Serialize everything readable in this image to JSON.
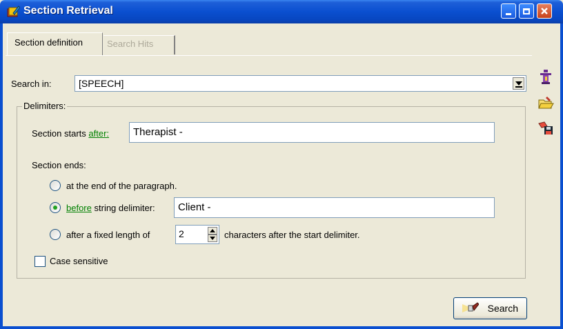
{
  "window": {
    "title": "Section Retrieval",
    "icon": "book-pencil-icon",
    "controls": [
      "minimize",
      "maximize",
      "close"
    ],
    "accent": "#0a4fd0"
  },
  "tabs": [
    {
      "label": "Section definition",
      "active": true
    },
    {
      "label": "Search Hits",
      "active": false
    }
  ],
  "search_in": {
    "label": "Search in:",
    "value": "[SPEECH]"
  },
  "delimiters": {
    "group_label": "Delimiters:",
    "starts_prefix": "Section starts",
    "starts_link": "after:",
    "starts_value": "Therapist -",
    "ends_label": "Section ends:",
    "option_paragraph": "at the end of the paragraph.",
    "option_before_link": "before",
    "option_before_text": "string delimiter:",
    "option_before_value": "Client -",
    "option_fixed_prefix": "after a fixed length of",
    "option_fixed_value": "2",
    "option_fixed_suffix": "characters after the start delimiter.",
    "selected_option": "before"
  },
  "case_sensitive": {
    "label": "Case sensitive",
    "checked": false
  },
  "side_toolbar": [
    "info-icon",
    "open-folder-icon",
    "save-icon"
  ],
  "search_button": {
    "label": "Search",
    "icon": "flashlight-icon"
  }
}
